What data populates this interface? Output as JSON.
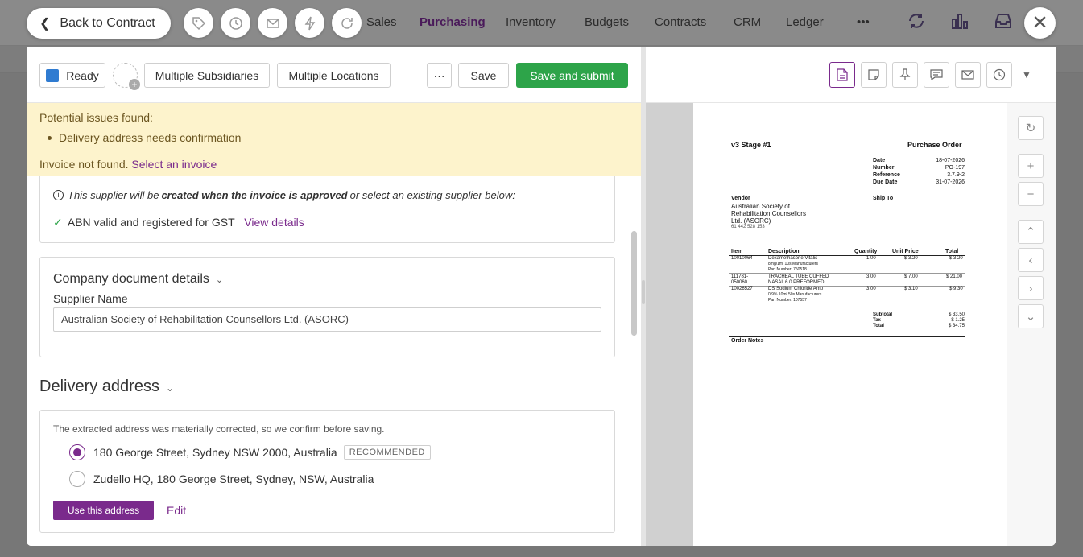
{
  "nav": {
    "items": [
      "Sales",
      "Purchasing",
      "Inventory",
      "Budgets",
      "Contracts",
      "CRM",
      "Ledger",
      "•••"
    ],
    "active": "Purchasing",
    "back_label": "Back to Contract"
  },
  "toolbar": {
    "status_label": "Ready",
    "subsidiaries_label": "Multiple Subsidiaries",
    "locations_label": "Multiple Locations",
    "more_label": "···",
    "save_label": "Save",
    "submit_label": "Save and submit",
    "status_color": "#2f7bd1",
    "submit_color": "#2da449"
  },
  "warning": {
    "title": "Potential issues found:",
    "issue": "Delivery address needs confirmation",
    "invoice_text": "Invoice not found.",
    "invoice_link": "Select an invoice"
  },
  "supplier": {
    "note_pre": "This supplier will be",
    "note_bold": "created when the invoice is approved",
    "note_post": "or select an existing supplier below:",
    "abn_text": "ABN valid and registered for GST",
    "view_details": "View details"
  },
  "company_doc": {
    "heading": "Company document details",
    "supplier_label": "Supplier Name",
    "supplier_value": "Australian Society of Rehabilitation Counsellors Ltd. (ASORC)"
  },
  "delivery": {
    "heading": "Delivery address",
    "description": "The extracted address was materially corrected, so we confirm before saving.",
    "options": [
      {
        "label": "180 George Street, Sydney NSW 2000, Australia",
        "badge": "RECOMMENDED",
        "selected": true
      },
      {
        "label": "Zudello HQ, 180 George Street, Sydney, NSW, Australia",
        "selected": false
      }
    ],
    "use_label": "Use this address",
    "edit_label": "Edit"
  },
  "document": {
    "company": "v3 Stage #1",
    "doc_title": "Purchase Order",
    "meta": [
      {
        "k": "Date",
        "v": "18-07-2026"
      },
      {
        "k": "Number",
        "v": "PO-197"
      },
      {
        "k": "Reference",
        "v": "3.7.9-2"
      },
      {
        "k": "Due Date",
        "v": "31-07-2026"
      }
    ],
    "vendor_label": "Vendor",
    "vendor_lines": [
      "Australian Society of",
      "Rehabilitation Counsellors",
      "Ltd. (ASORC)",
      "61 442 528 153"
    ],
    "ship_to_label": "Ship To",
    "headers": [
      "Item",
      "Description",
      "Quantity",
      "Unit Price",
      "Total"
    ],
    "rows": [
      {
        "item": "10010064",
        "desc": [
          "Dexamethasone Vitalis",
          "8mg/1ml 10s Manufacturers",
          "Part Number: 750518"
        ],
        "qty": "1.00",
        "price": "$ 3.20",
        "total": "$ 3.20"
      },
      {
        "item": "111781-",
        "item2": "050060",
        "desc": [
          "TRACHEAL TUBE CUFFED",
          "NASAL 6.0 PREFORMED"
        ],
        "qty": "3.00",
        "price": "$ 7.00",
        "total": "$ 21.00"
      },
      {
        "item": "10026527",
        "desc": [
          "DS Sodium Chloride Amp",
          "0.9% 10ml 50s Manufacturers",
          "Part Number: 107557"
        ],
        "qty": "3.00",
        "price": "$ 3.10",
        "total": "$ 9.30"
      }
    ],
    "totals": [
      {
        "k": "Subtotal",
        "v": "$ 33.50"
      },
      {
        "k": "Tax",
        "v": "$ 1.25"
      },
      {
        "k": "Total",
        "v": "$ 34.75"
      }
    ],
    "notes_label": "Order Notes"
  }
}
